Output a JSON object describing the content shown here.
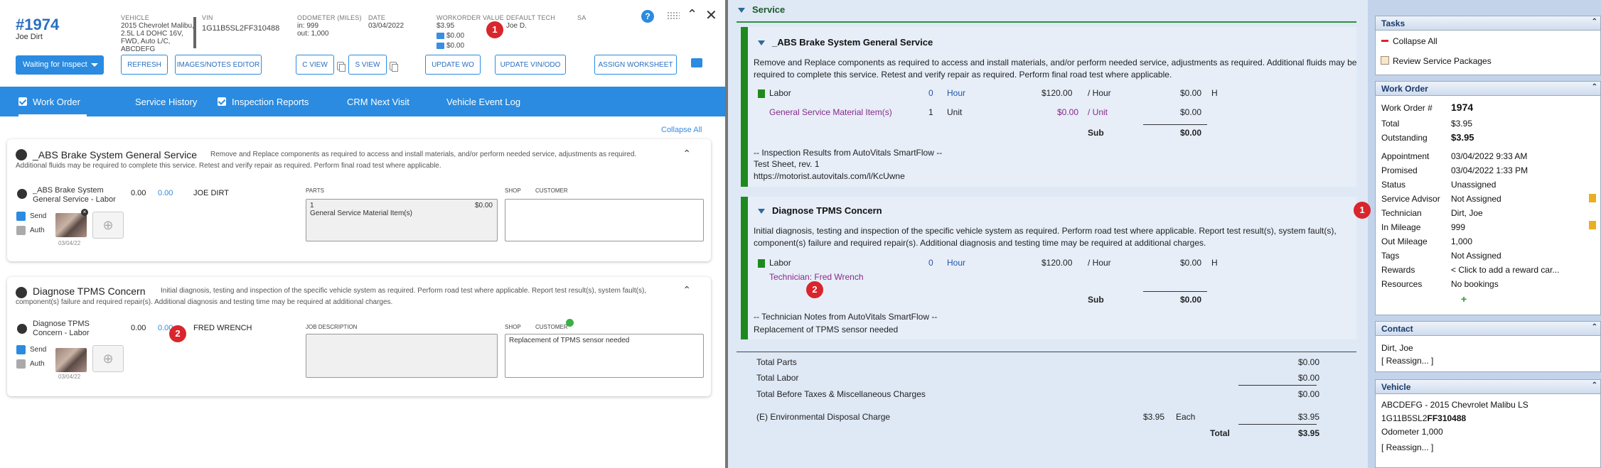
{
  "header": {
    "wo_number": "#1974",
    "customer": "Joe Dirt",
    "vehicle_label": "VEHICLE",
    "vehicle_lines": [
      "2015 Chevrolet Malibu,",
      "2.5L L4 DOHC 16V,",
      "FWD, Auto L/C,",
      "ABCDEFG"
    ],
    "vin_label": "VIN",
    "vin": "1G11B5SL2FF310488",
    "odometer_label": "ODOMETER (MILES)",
    "odometer_in": "in: 999",
    "odometer_out": "out: 1,000",
    "date_label": "DATE",
    "date": "03/04/2022",
    "wo_value_label": "WORKORDER VALUE",
    "wo_value": "$3.95",
    "wo_value_a": "$0.00",
    "wo_value_b": "$0.00",
    "tech_label": "DEFAULT TECH",
    "tech": "Joe D.",
    "sa_label": "SA",
    "status": "Waiting for Inspect",
    "buttons": {
      "refresh": "REFRESH",
      "images": "IMAGES/NOTES EDITOR",
      "cview": "C VIEW",
      "sview": "S VIEW",
      "update_wo": "UPDATE WO",
      "update_vin": "UPDATE VIN/ODO",
      "assign": "ASSIGN WORKSHEET"
    },
    "help": "?"
  },
  "tabs": [
    "Work Order",
    "Service History",
    "Inspection Reports",
    "CRM Next Visit",
    "Vehicle Event Log"
  ],
  "collapse_all": "Collapse All",
  "cards": [
    {
      "title": "_ABS Brake System General Service",
      "desc1": "Remove and Replace components as required to access and install materials, and/or perform needed service, adjustments as required.",
      "desc2": "Additional fluids may be required to complete this service. Retest and verify repair as required. Perform final road test where applicable.",
      "labor": "_ABS Brake System General Service - Labor",
      "hours": "0.00",
      "rate": "0.00",
      "tech": "JOE DIRT",
      "col1": "PARTS",
      "part_qty": "1",
      "part_price": "$0.00",
      "part_name": "General Service Material Item(s)",
      "shop": "SHOP",
      "customer": "CUSTOMER",
      "customer_text": "",
      "send": "Send",
      "auth": "Auth",
      "date": "03/04/22"
    },
    {
      "title": "Diagnose TPMS Concern",
      "desc1": "Initial diagnosis, testing and inspection of the specific vehicle system as required. Perform road test where applicable. Report test result(s), system fault(s),",
      "desc2": "component(s) failure and required repair(s). Additional diagnosis and testing time may be required at additional charges.",
      "labor": "Diagnose TPMS Concern - Labor",
      "hours": "0.00",
      "rate": "0.00",
      "tech": "FRED WRENCH",
      "col1": "JOB DESCRIPTION",
      "shop": "SHOP",
      "customer": "CUSTOMER",
      "customer_text": "Replacement of TPMS sensor needed",
      "send": "Send",
      "auth": "Auth",
      "date": "03/04/22"
    }
  ],
  "badges": {
    "one": "1",
    "two": "2"
  },
  "middle": {
    "section": "Service",
    "s1": {
      "title": "_ABS Brake System General Service",
      "desc": "Remove and Replace components as required to access and install materials, and/or perform needed service, adjustments as required.  Additional fluids may be required to complete this service.  Retest and verify repair as required.  Perform final road test where applicable.",
      "labor": "Labor",
      "labor_qty": "0",
      "labor_unit": "Hour",
      "labor_rate": "$120.00",
      "labor_per": "/ Hour",
      "labor_total": "$0.00",
      "labor_flag": "H",
      "part": "General Service Material Item(s)",
      "part_qty": "1",
      "part_unit": "Unit",
      "part_rate": "$0.00",
      "part_per": "/ Unit",
      "part_total": "$0.00",
      "sub": "Sub",
      "sub_total": "$0.00",
      "note1": "-- Inspection Results from AutoVitals SmartFlow --",
      "note2": "Test Sheet, rev. 1",
      "note3": "https://motorist.autovitals.com/l/KcUwne"
    },
    "s2": {
      "title": "Diagnose TPMS Concern",
      "desc": "Initial diagnosis, testing and inspection of the specific vehicle system as required.  Perform road test where applicable.  Report test result(s), system fault(s), component(s) failure and required repair(s).  Additional diagnosis and testing time may be required at additional charges.",
      "labor": "Labor",
      "labor_qty": "0",
      "labor_unit": "Hour",
      "labor_rate": "$120.00",
      "labor_per": "/ Hour",
      "labor_total": "$0.00",
      "labor_flag": "H",
      "technician": "Technician: Fred Wrench",
      "sub": "Sub",
      "sub_total": "$0.00",
      "note1": "-- Technician Notes from AutoVitals SmartFlow --",
      "note2": "Replacement of TPMS sensor needed"
    },
    "totals": {
      "parts": "Total Parts",
      "parts_v": "$0.00",
      "labor": "Total Labor",
      "labor_v": "$0.00",
      "before": "Total Before Taxes & Miscellaneous Charges",
      "before_v": "$0.00",
      "env": "(E) Environmental Disposal Charge",
      "env_rate": "$3.95",
      "env_each": "Each",
      "env_v": "$3.95",
      "total": "Total",
      "total_v": "$3.95"
    }
  },
  "right": {
    "tasks": {
      "title": "Tasks",
      "collapse": "Collapse All",
      "review": "Review Service Packages"
    },
    "workorder": {
      "title": "Work Order",
      "rows": [
        [
          "Work Order #",
          "1974"
        ],
        [
          "Total",
          "$3.95"
        ],
        [
          "Outstanding",
          "$3.95"
        ],
        [
          "Appointment",
          "03/04/2022 9:33 AM"
        ],
        [
          "Promised",
          "03/04/2022 1:33 PM"
        ],
        [
          "Status",
          "Unassigned"
        ],
        [
          "Service Advisor",
          "Not Assigned"
        ],
        [
          "Technician",
          "Dirt, Joe"
        ],
        [
          "In Mileage",
          "999"
        ],
        [
          "Out Mileage",
          "1,000"
        ],
        [
          "Tags",
          "Not Assigned"
        ],
        [
          "Rewards",
          "< Click to add a reward car..."
        ],
        [
          "Resources",
          "No bookings"
        ]
      ]
    },
    "contact": {
      "title": "Contact",
      "name": "Dirt, Joe",
      "reassign": "[ Reassign... ]"
    },
    "vehicle": {
      "title": "Vehicle",
      "desc": "ABCDEFG - 2015 Chevrolet Malibu LS",
      "vin_a": "1G11B5SL2",
      "vin_b": "FF310488",
      "odometer": "Odometer 1,000",
      "reassign": "[ Reassign... ]"
    }
  }
}
